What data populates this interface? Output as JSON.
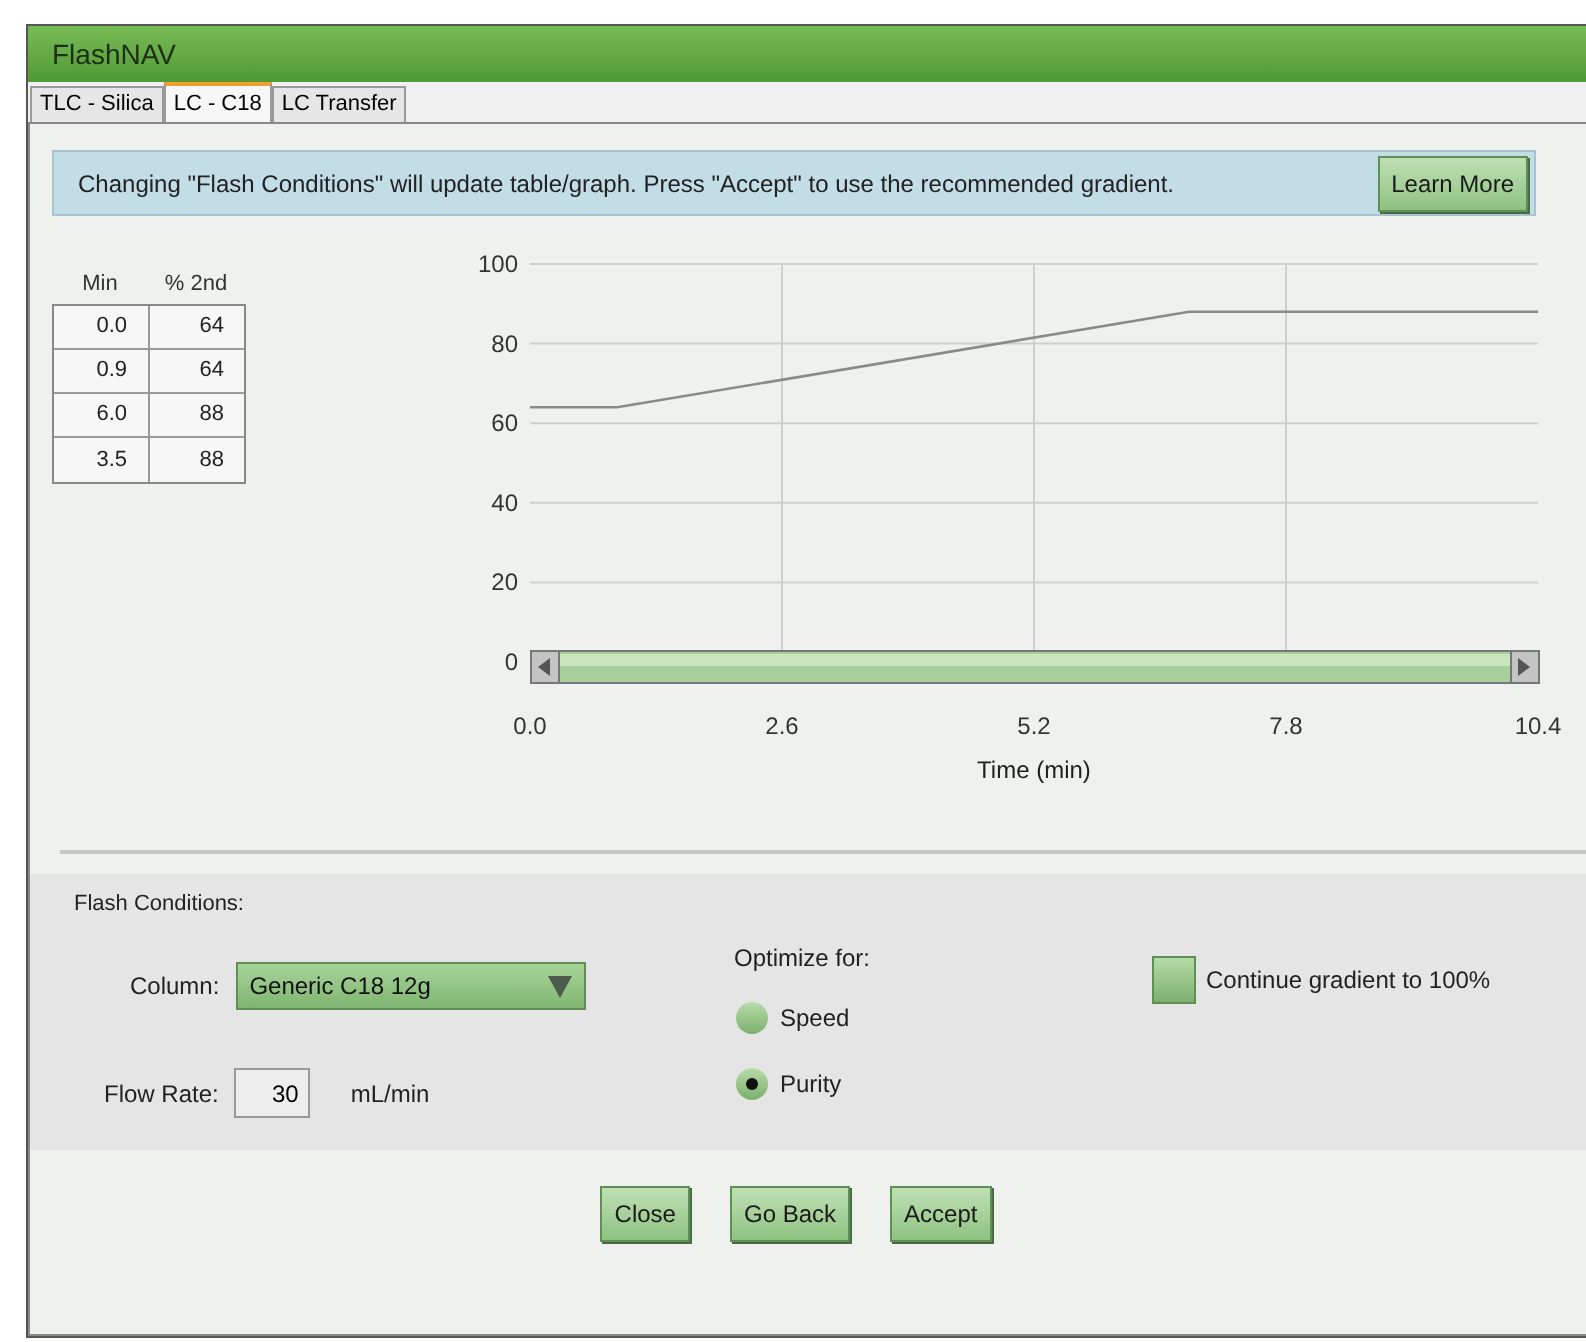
{
  "window": {
    "title": "FlashNAV"
  },
  "tabs": [
    {
      "label": "TLC - Silica",
      "selected": false
    },
    {
      "label": "LC - C18",
      "selected": true
    },
    {
      "label": "LC Transfer",
      "selected": false
    }
  ],
  "banner": {
    "text": "Changing \"Flash Conditions\" will update table/graph. Press \"Accept\" to use the recommended gradient.",
    "button": "Learn More"
  },
  "gradient_table": {
    "columns": [
      "Min",
      "% 2nd"
    ],
    "rows": [
      [
        "0.0",
        "64"
      ],
      [
        "0.9",
        "64"
      ],
      [
        "6.0",
        "88"
      ],
      [
        "3.5",
        "88"
      ]
    ]
  },
  "chart_data": {
    "type": "line",
    "xlabel": "Time (min)",
    "x": [
      0,
      0.9,
      6.8,
      10.4
    ],
    "series": [
      {
        "color": "#8a8a8a",
        "values": [
          64,
          64,
          88,
          88
        ]
      }
    ],
    "grid": true,
    "xlim": [
      0,
      10.4
    ],
    "ylim": [
      0,
      100
    ],
    "xticks": [
      {
        "value": 0,
        "label": "0.0"
      },
      2.6,
      5.2,
      7.8,
      10.4
    ],
    "yticks": [
      0,
      20,
      40,
      60,
      80,
      100
    ]
  },
  "flash_conditions": {
    "title": "Flash Conditions:",
    "column_label": "Column:",
    "column_value": "Generic C18 12g",
    "flow_label": "Flow Rate:",
    "flow_value": "30",
    "flow_unit": "mL/min",
    "optimize_label": "Optimize for:",
    "options": [
      {
        "label": "Speed",
        "selected": false
      },
      {
        "label": "Purity",
        "selected": true
      }
    ],
    "continue_gradient": {
      "label": "Continue gradient to 100%",
      "checked": false
    }
  },
  "buttons": [
    "Close",
    "Go Back",
    "Accept"
  ]
}
